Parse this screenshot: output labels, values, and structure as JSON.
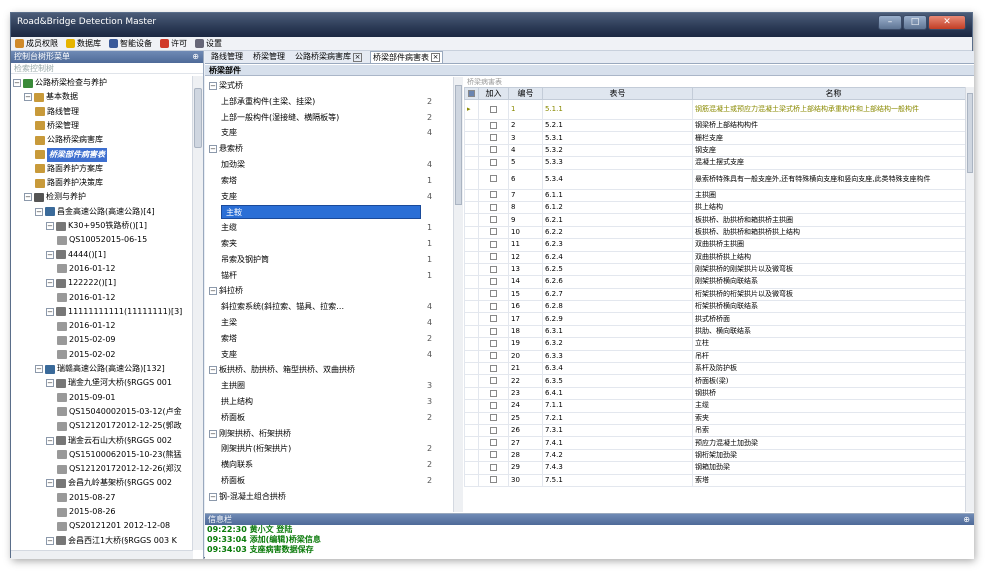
{
  "app": {
    "title": "Road&Bridge Detection Master"
  },
  "menu": [
    {
      "label": "成员权限",
      "color": "#d08a2a"
    },
    {
      "label": "数据库",
      "color": "#e6b400"
    },
    {
      "label": "智能设备",
      "color": "#3a5a9a"
    },
    {
      "label": "许可",
      "color": "#d03a2a"
    },
    {
      "label": "设置",
      "color": "#667"
    }
  ],
  "left": {
    "header": "控制台树形菜单",
    "pin": "⊕",
    "filter": "检索控制树"
  },
  "tree": [
    {
      "t": "公路桥梁检查与养护",
      "lv": 0,
      "tog": "⊟",
      "ic": "#3a8a3a"
    },
    {
      "t": "基本数据",
      "lv": 1,
      "tog": "⊟",
      "ic": "#c89a3a"
    },
    {
      "t": "路线管理",
      "lv": 2,
      "ic": "#c89a3a"
    },
    {
      "t": "桥梁管理",
      "lv": 2,
      "ic": "#c89a3a"
    },
    {
      "t": "公路桥梁病害库",
      "lv": 2,
      "ic": "#c89a3a"
    },
    {
      "t": "桥梁部件病害表",
      "lv": 2,
      "ic": "#c89a3a",
      "sel": true
    },
    {
      "t": "路面养护方案库",
      "lv": 2,
      "ic": "#c89a3a"
    },
    {
      "t": "路面养护决策库",
      "lv": 2,
      "ic": "#c89a3a"
    },
    {
      "t": "检测与养护",
      "lv": 1,
      "tog": "⊟",
      "ic": "#555"
    },
    {
      "t": "昌金高速公路(高速公路)[4]",
      "lv": 2,
      "tog": "⊟",
      "ic": "#3a6a9a"
    },
    {
      "t": "K30+950铁路桥()[1]",
      "lv": 3,
      "tog": "⊟",
      "ic": "#777"
    },
    {
      "t": "QS10052015-06-15",
      "lv": 4,
      "ic": "#999"
    },
    {
      "t": "4444()[1]",
      "lv": 3,
      "tog": "⊟",
      "ic": "#777"
    },
    {
      "t": "2016-01-12",
      "lv": 4,
      "ic": "#999"
    },
    {
      "t": "122222()[1]",
      "lv": 3,
      "tog": "⊟",
      "ic": "#777"
    },
    {
      "t": "2016-01-12",
      "lv": 4,
      "ic": "#999"
    },
    {
      "t": "11111111111(11111111)[3]",
      "lv": 3,
      "tog": "⊟",
      "ic": "#777"
    },
    {
      "t": "2016-01-12",
      "lv": 4,
      "ic": "#999"
    },
    {
      "t": "2015-02-09",
      "lv": 4,
      "ic": "#999"
    },
    {
      "t": "2015-02-02",
      "lv": 4,
      "ic": "#999"
    },
    {
      "t": "瑞赣高速公路(高速公路)[132]",
      "lv": 2,
      "tog": "⊟",
      "ic": "#3a6a9a"
    },
    {
      "t": "瑞金九堡河大桥(§RGGS 001",
      "lv": 3,
      "tog": "⊟",
      "ic": "#777"
    },
    {
      "t": "2015-09-01",
      "lv": 4,
      "ic": "#999"
    },
    {
      "t": "QS15040002015-03-12(卢金",
      "lv": 4,
      "ic": "#999"
    },
    {
      "t": "QS12120172012-12-25(郭政",
      "lv": 4,
      "ic": "#999"
    },
    {
      "t": "瑞金云石山大桥(§RGGS 002",
      "lv": 3,
      "tog": "⊟",
      "ic": "#777"
    },
    {
      "t": "QS15100062015-10-23(熊猛",
      "lv": 4,
      "ic": "#999"
    },
    {
      "t": "QS12120172012-12-26(郑汉",
      "lv": 4,
      "ic": "#999"
    },
    {
      "t": "会昌九岭基架桥(§RGGS 002",
      "lv": 3,
      "tog": "⊟",
      "ic": "#777"
    },
    {
      "t": "2015-08-27",
      "lv": 4,
      "ic": "#999"
    },
    {
      "t": "2015-08-26",
      "lv": 4,
      "ic": "#999"
    },
    {
      "t": "QS20121201 2012-12-08",
      "lv": 4,
      "ic": "#999"
    },
    {
      "t": "会昌西江1大桥(§RGGS 003  K",
      "lv": 3,
      "tog": "⊟",
      "ic": "#777"
    }
  ],
  "tabs": [
    {
      "label": "路线管理"
    },
    {
      "label": "桥梁管理"
    },
    {
      "label": "公路桥梁病害库",
      "close": "×"
    },
    {
      "label": "桥梁部件病害表",
      "close": "×",
      "active": true
    }
  ],
  "section_title": "桥梁部件",
  "categories": [
    {
      "t": "梁式桥",
      "g": true
    },
    {
      "t": "上部承重构件(主梁、挂梁)",
      "n": "2"
    },
    {
      "t": "上部一般构件(湿接缝、横隔板等)",
      "n": "2"
    },
    {
      "t": "支座",
      "n": "4"
    },
    {
      "t": "悬索桥",
      "g": true
    },
    {
      "t": "加劲梁",
      "n": "4"
    },
    {
      "t": "索塔",
      "n": "1"
    },
    {
      "t": "支座",
      "n": "4"
    },
    {
      "t": "主鞍",
      "sel": true
    },
    {
      "t": "主缆",
      "n": "1"
    },
    {
      "t": "索夹",
      "n": "1"
    },
    {
      "t": "吊索及钢护筒",
      "n": "1"
    },
    {
      "t": "锚杆",
      "n": "1"
    },
    {
      "t": "斜拉桥",
      "g": true
    },
    {
      "t": "斜拉索系统(斜拉索、锚具、拉索…",
      "n": "4"
    },
    {
      "t": "主梁",
      "n": "4"
    },
    {
      "t": "索塔",
      "n": "2"
    },
    {
      "t": "支座",
      "n": "4"
    },
    {
      "t": "板拱桥、肋拱桥、箱型拱桥、双曲拱桥",
      "g": true
    },
    {
      "t": "主拱圈",
      "n": "3"
    },
    {
      "t": "拱上结构",
      "n": "3"
    },
    {
      "t": "桥面板",
      "n": "2"
    },
    {
      "t": "刚架拱桥、桁架拱桥",
      "g": true
    },
    {
      "t": "刚架拱片(桁架拱片)",
      "n": "2"
    },
    {
      "t": "横向联系",
      "n": "2"
    },
    {
      "t": "桥面板",
      "n": "2"
    },
    {
      "t": "钢-混凝土组合拱桥",
      "g": true
    }
  ],
  "grid": {
    "label": "桥梁病害表",
    "headers": [
      "加入",
      "编号",
      "表号",
      "名称"
    ],
    "rows": [
      [
        "1",
        "5.1.1",
        "钢筋混凝土或预应力混凝土梁式桥上部结构承重构件和上部结构一般构件"
      ],
      [
        "2",
        "5.2.1",
        "钢梁桥上部结构构件"
      ],
      [
        "3",
        "5.3.1",
        "栅栏支座"
      ],
      [
        "4",
        "5.3.2",
        "钢支座"
      ],
      [
        "5",
        "5.3.3",
        "混凝土摆式支座"
      ],
      [
        "6",
        "5.3.4",
        "悬索桥特殊具有一般支座外,还有特殊横向支座和竖向支座,此类特殊支座构件"
      ],
      [
        "7",
        "6.1.1",
        "主拱圈"
      ],
      [
        "8",
        "6.1.2",
        "拱上结构"
      ],
      [
        "9",
        "6.2.1",
        "板拱桥、肋拱桥和箱拱桥主拱圈"
      ],
      [
        "10",
        "6.2.2",
        "板拱桥、肋拱桥和箱拱桥拱上结构"
      ],
      [
        "11",
        "6.2.3",
        "双曲拱桥主拱圈"
      ],
      [
        "12",
        "6.2.4",
        "双曲拱桥拱上结构"
      ],
      [
        "13",
        "6.2.5",
        "刚架拱桥的刚架拱片以及微弯板"
      ],
      [
        "14",
        "6.2.6",
        "刚架拱桥横向联结系"
      ],
      [
        "15",
        "6.2.7",
        "桁架拱桥的桁架拱片以及微弯板"
      ],
      [
        "16",
        "6.2.8",
        "桁架拱桥横向联结系"
      ],
      [
        "17",
        "6.2.9",
        "拱式桥桥面"
      ],
      [
        "18",
        "6.3.1",
        "拱肋、横向联结系"
      ],
      [
        "19",
        "6.3.2",
        "立柱"
      ],
      [
        "20",
        "6.3.3",
        "吊杆"
      ],
      [
        "21",
        "6.3.4",
        "系杆及防护板"
      ],
      [
        "22",
        "6.3.5",
        "桥面板(梁)"
      ],
      [
        "23",
        "6.4.1",
        "钢拱桥"
      ],
      [
        "24",
        "7.1.1",
        "主缆"
      ],
      [
        "25",
        "7.2.1",
        "索夹"
      ],
      [
        "26",
        "7.3.1",
        "吊索"
      ],
      [
        "27",
        "7.4.1",
        "预应力混凝土加劲梁"
      ],
      [
        "28",
        "7.4.2",
        "钢桁架加劲梁"
      ],
      [
        "29",
        "7.4.3",
        "钢箱加劲梁"
      ],
      [
        "30",
        "7.5.1",
        "索塔"
      ]
    ]
  },
  "info": {
    "header": "信息栏",
    "pin": "⊕",
    "logs": [
      "09:22:30  黄小文 登陆",
      "09:33:04  添加(编辑)桥梁信息",
      "09:34:03  支座病害数据保存"
    ]
  }
}
